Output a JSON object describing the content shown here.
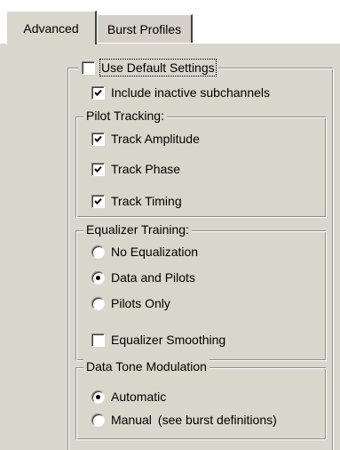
{
  "tabs": [
    {
      "label": "Advanced",
      "active": true
    },
    {
      "label": "Burst Profiles",
      "active": false
    }
  ],
  "use_default": {
    "label": "Use Default Settings",
    "checked": false,
    "focused": true
  },
  "include_inactive": {
    "label": "Include inactive subchannels",
    "checked": true
  },
  "pilot_tracking": {
    "title": "Pilot Tracking:",
    "items": [
      {
        "label": "Track Amplitude",
        "checked": true
      },
      {
        "label": "Track Phase",
        "checked": true
      },
      {
        "label": "Track Timing",
        "checked": true
      }
    ]
  },
  "equalizer_training": {
    "title": "Equalizer Training:",
    "options": [
      {
        "label": "No Equalization",
        "selected": false
      },
      {
        "label": "Data and Pilots",
        "selected": true
      },
      {
        "label": "Pilots Only",
        "selected": false
      }
    ],
    "smoothing": {
      "label": "Equalizer Smoothing",
      "checked": false
    }
  },
  "data_tone_modulation": {
    "title": "Data Tone Modulation",
    "options": [
      {
        "label": "Automatic",
        "selected": true
      },
      {
        "label": "Manual",
        "selected": false,
        "note": "(see burst definitions)"
      }
    ]
  },
  "colors": {
    "face": "#d9d6cc",
    "shadow": "#8f8d88",
    "highlight": "#ffffff",
    "check": "#000000"
  },
  "icons": {
    "check": "checkmark-icon",
    "radio": "radio-dot-icon"
  }
}
